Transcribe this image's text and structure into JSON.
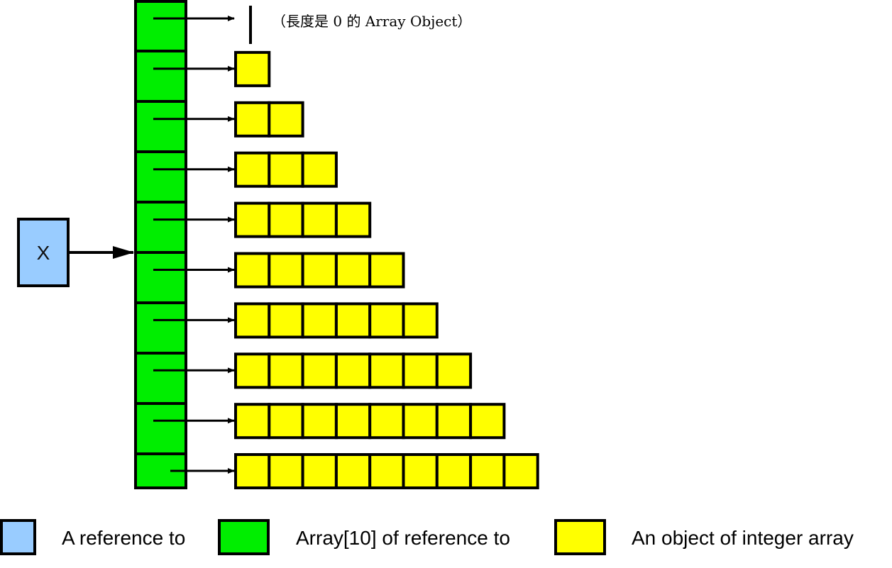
{
  "colors": {
    "reference": "#99ccff",
    "array_of_refs": "#00ee00",
    "int_array": "#ffff00",
    "stroke": "#000000"
  },
  "variable": {
    "label": "X"
  },
  "ref_array": {
    "length": 10
  },
  "int_arrays": {
    "lengths": [
      0,
      1,
      2,
      3,
      4,
      5,
      6,
      7,
      8,
      9
    ]
  },
  "note": "（長度是 0 的 Array Object）",
  "legend": [
    {
      "swatch": "reference",
      "label": "A reference to"
    },
    {
      "swatch": "array_of_refs",
      "label": "Array[10] of reference to"
    },
    {
      "swatch": "int_array",
      "label": "An object of integer array"
    }
  ]
}
